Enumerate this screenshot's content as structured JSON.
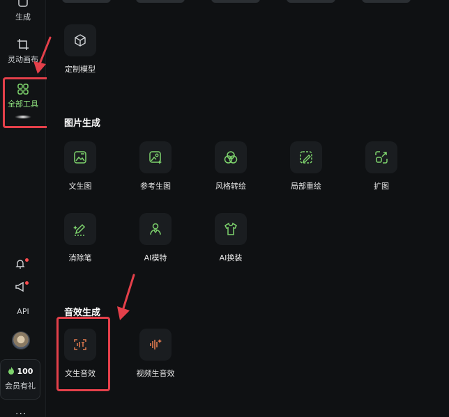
{
  "sidebar": {
    "items": [
      {
        "label": "生成",
        "icon": "generate-icon"
      },
      {
        "label": "灵动画布",
        "icon": "canvas-icon"
      },
      {
        "label": "全部工具",
        "icon": "all-tools-icon",
        "active": true
      }
    ],
    "api_label": "API",
    "member": {
      "points": "100",
      "label": "会员有礼"
    },
    "more": "···"
  },
  "custom_model": {
    "label": "定制模型",
    "icon": "cube-icon"
  },
  "sections": {
    "image": {
      "title": "图片生成",
      "tools": [
        {
          "label": "文生图",
          "icon": "text-to-image-icon"
        },
        {
          "label": "参考生图",
          "icon": "reference-image-icon"
        },
        {
          "label": "风格转绘",
          "icon": "style-transfer-icon"
        },
        {
          "label": "局部重绘",
          "icon": "inpaint-icon"
        },
        {
          "label": "扩图",
          "icon": "expand-image-icon"
        },
        {
          "label": "消除笔",
          "icon": "eraser-pen-icon"
        },
        {
          "label": "AI模特",
          "icon": "ai-model-icon"
        },
        {
          "label": "AI换装",
          "icon": "ai-outfit-icon"
        }
      ]
    },
    "audio": {
      "title": "音效生成",
      "tools": [
        {
          "label": "文生音效",
          "icon": "text-to-sound-icon"
        },
        {
          "label": "视频生音效",
          "icon": "video-to-sound-icon"
        }
      ]
    }
  },
  "colors": {
    "accent_green": "#7ed46d",
    "accent_orange": "#e07a4f",
    "annotation_red": "#e4404a",
    "background": "#0f1113"
  }
}
